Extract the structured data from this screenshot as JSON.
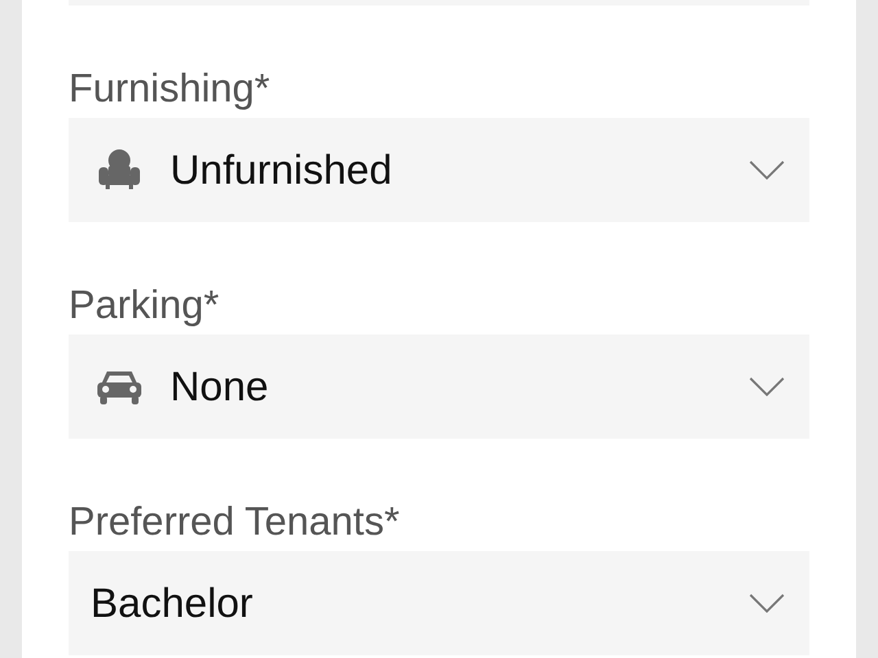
{
  "fields": [
    {
      "label": "Furnishing*",
      "value": "Unfurnished",
      "kind": "icon-select"
    },
    {
      "label": "Parking*",
      "value": "None",
      "kind": "icon-select"
    },
    {
      "label": "Preferred Tenants*",
      "value": "Bachelor",
      "kind": "plain-select"
    }
  ]
}
